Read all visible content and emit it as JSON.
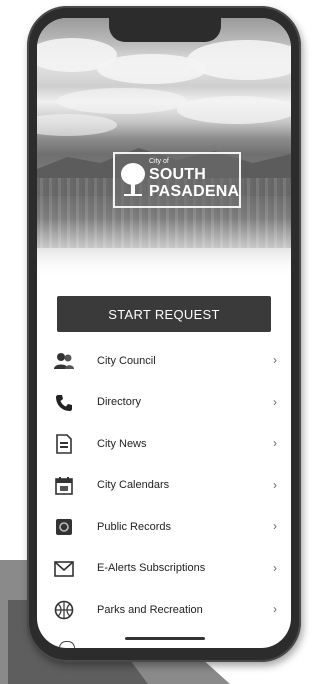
{
  "logo": {
    "small_text": "City of",
    "line1": "SOUTH",
    "line2": "PASADENA"
  },
  "start_button": {
    "label": "START REQUEST"
  },
  "menu": {
    "items": [
      {
        "label": "City Council",
        "icon": "people-icon"
      },
      {
        "label": "Directory",
        "icon": "phone-icon"
      },
      {
        "label": "City News",
        "icon": "newspaper-icon"
      },
      {
        "label": "City Calendars",
        "icon": "calendar-icon"
      },
      {
        "label": "Public Records",
        "icon": "records-icon"
      },
      {
        "label": "E-Alerts Subscriptions",
        "icon": "envelope-icon"
      },
      {
        "label": "Parks and Recreation",
        "icon": "ball-icon"
      }
    ],
    "chevron": "›"
  },
  "colors": {
    "button": "#3a3a3a",
    "text": "#222222"
  }
}
